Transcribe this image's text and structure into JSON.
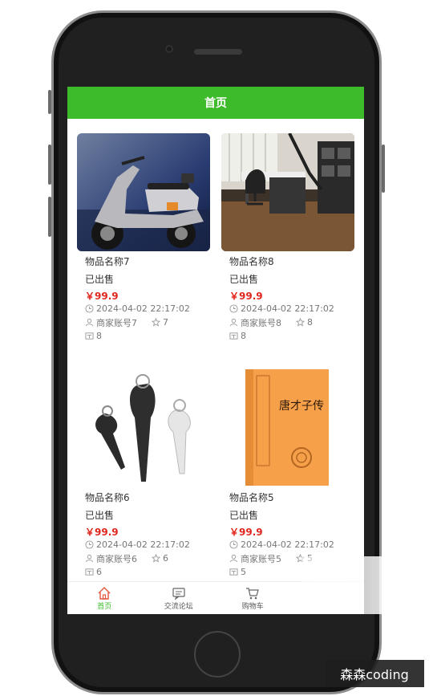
{
  "header": {
    "title": "首页"
  },
  "products": [
    {
      "name": "物品名称7",
      "status": "已出售",
      "price": "￥99.9",
      "time": "2024-04-02 22:17:02",
      "seller": "商家账号7",
      "stars": "7",
      "count": "8",
      "image": "scooter"
    },
    {
      "name": "物品名称8",
      "status": "已出售",
      "price": "￥99.9",
      "time": "2024-04-02 22:17:02",
      "seller": "商家账号8",
      "stars": "8",
      "count": "8",
      "image": "office"
    },
    {
      "name": "物品名称6",
      "status": "已出售",
      "price": "￥99.9",
      "time": "2024-04-02 22:17:02",
      "seller": "商家账号6",
      "stars": "6",
      "count": "6",
      "image": "earphones"
    },
    {
      "name": "物品名称5",
      "status": "已出售",
      "price": "￥99.9",
      "time": "2024-04-02 22:17:02",
      "seller": "商家账号5",
      "stars": "5",
      "count": "5",
      "image": "book",
      "book_title": "唐才子传"
    }
  ],
  "tabs": [
    {
      "label": "首页",
      "icon": "home-icon",
      "active": true
    },
    {
      "label": "交流论坛",
      "icon": "forum-icon",
      "active": false
    },
    {
      "label": "购物车",
      "icon": "cart-icon",
      "active": false
    }
  ],
  "colors": {
    "primary": "#3dbb2b",
    "price": "#e0271f"
  },
  "watermark": "森森coding"
}
